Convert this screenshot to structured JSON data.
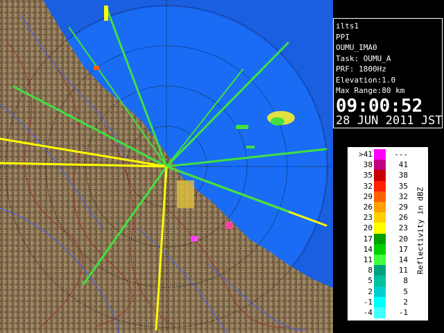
{
  "info": {
    "site": "ilts1",
    "mode": "PPI",
    "radar_id": "OUMU_IMA0",
    "task": "Task: OUMU_A",
    "prf": "PRF: 1800Hz",
    "elevation": "Elevation:1.0",
    "max_range": "Max Range:80 km",
    "time": "09:00:52",
    "date": "28 JUN 2011 JST"
  },
  "legend": {
    "title": "Reflectivity in dBZ",
    "rows": [
      {
        "low": ">41",
        "high": "---",
        "color": "#ff00ff"
      },
      {
        "low": "38",
        "high": "41",
        "color": "#c00080"
      },
      {
        "low": "35",
        "high": "38",
        "color": "#c80000"
      },
      {
        "low": "32",
        "high": "35",
        "color": "#ff2000"
      },
      {
        "low": "29",
        "high": "32",
        "color": "#ff6000"
      },
      {
        "low": "26",
        "high": "29",
        "color": "#ffa000"
      },
      {
        "low": "23",
        "high": "26",
        "color": "#ffd000"
      },
      {
        "low": "20",
        "high": "23",
        "color": "#ffff00"
      },
      {
        "low": "17",
        "high": "20",
        "color": "#00a000"
      },
      {
        "low": "14",
        "high": "17",
        "color": "#00d000"
      },
      {
        "low": "11",
        "high": "14",
        "color": "#40ff40"
      },
      {
        "low": "8",
        "high": "11",
        "color": "#00a080"
      },
      {
        "low": "5",
        "high": "8",
        "color": "#00c0a0"
      },
      {
        "low": "2",
        "high": "5",
        "color": "#00d0d0"
      },
      {
        "low": "-1",
        "high": "2",
        "color": "#00ffff"
      },
      {
        "low": "-4",
        "high": "-1",
        "color": "#40ffff"
      }
    ]
  }
}
